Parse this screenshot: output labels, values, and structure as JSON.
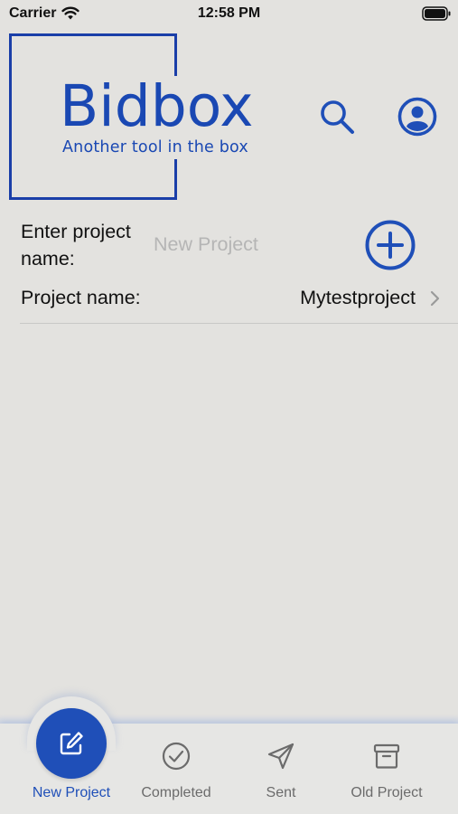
{
  "status_bar": {
    "carrier": "Carrier",
    "time": "12:58 PM",
    "icons": [
      "wifi-icon",
      "battery-icon"
    ]
  },
  "header": {
    "logo_title": "Bidbox",
    "logo_tagline": "Another tool in the box",
    "icons": [
      "search-icon",
      "profile-icon"
    ]
  },
  "form": {
    "enter_label": "Enter project name:",
    "input_value": "",
    "input_placeholder": "New Project",
    "add_icon": "plus-circle-icon"
  },
  "project_row": {
    "label": "Project name:",
    "value": "Mytestproject",
    "icon": "chevron-right-icon"
  },
  "tabbar": {
    "tabs": [
      {
        "label": "New Project",
        "icon": "edit-square-icon",
        "selected": true
      },
      {
        "label": "Completed",
        "icon": "check-circle-icon",
        "selected": false
      },
      {
        "label": "Sent",
        "icon": "send-icon",
        "selected": false
      },
      {
        "label": "Old Project",
        "icon": "archive-icon",
        "selected": false
      }
    ]
  },
  "colors": {
    "accent": "#1f4fb8",
    "background": "#e3e2df",
    "placeholder": "#b5b5b5",
    "inactive_tab": "#6b6b6b"
  }
}
